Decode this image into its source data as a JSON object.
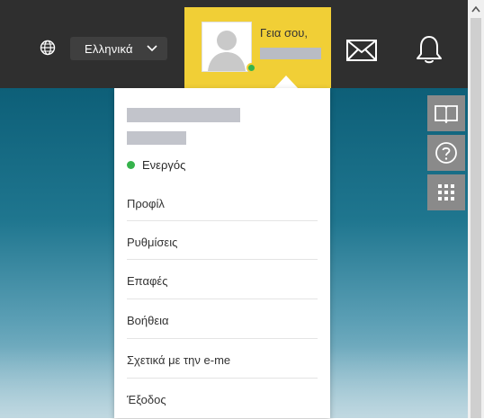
{
  "header": {
    "language": "Ελληνικά",
    "greeting": "Γεια σου,",
    "icons": [
      "globe-icon",
      "chevron-down-icon",
      "mail-icon",
      "bell-icon"
    ]
  },
  "user_menu": {
    "status": "Ενεργός",
    "status_color": "#36b34c",
    "items": [
      {
        "label": "Προφίλ"
      },
      {
        "label": "Ρυθμίσεις"
      },
      {
        "label": "Επαφές"
      },
      {
        "label": "Βοήθεια"
      },
      {
        "label": "Σχετικά με την e-me"
      },
      {
        "label": "Έξοδος"
      }
    ]
  },
  "side_buttons": [
    "book-icon",
    "help-icon",
    "apps-grid-icon"
  ],
  "colors": {
    "topbar": "#2f2f2f",
    "accent": "#f1cf36",
    "side_button": "#8a8a8a",
    "background": "#1f768f"
  }
}
